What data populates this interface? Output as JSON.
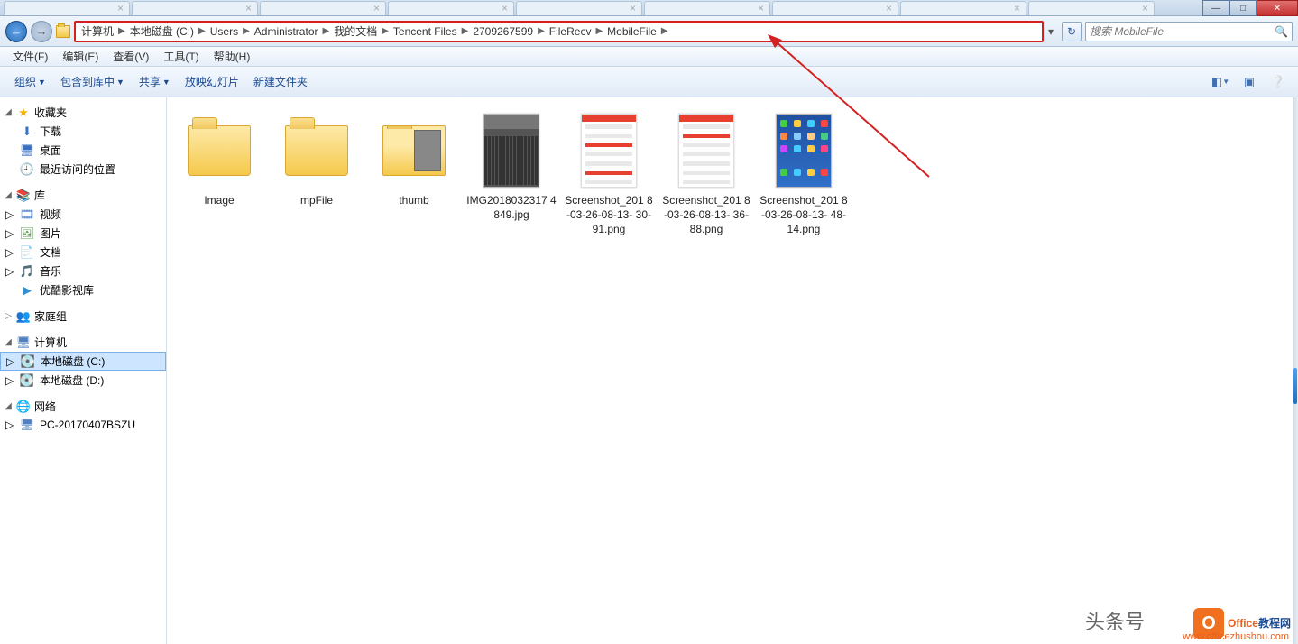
{
  "window": {
    "minimize": "—",
    "maximize": "□",
    "close": "✕"
  },
  "tabs": [
    {
      "label": " "
    },
    {
      "label": " "
    },
    {
      "label": " "
    },
    {
      "label": " "
    },
    {
      "label": " "
    },
    {
      "label": " "
    },
    {
      "label": " "
    },
    {
      "label": " "
    },
    {
      "label": " "
    },
    {
      "label": " "
    }
  ],
  "nav": {
    "back": "←",
    "forward": "→",
    "refresh": "↻"
  },
  "breadcrumb": [
    "计算机",
    "本地磁盘 (C:)",
    "Users",
    "Administrator",
    "我的文档",
    "Tencent Files",
    "2709267599",
    "FileRecv",
    "MobileFile"
  ],
  "search": {
    "placeholder": "搜索 MobileFile"
  },
  "menu": [
    "文件(F)",
    "编辑(E)",
    "查看(V)",
    "工具(T)",
    "帮助(H)"
  ],
  "toolbar": {
    "organize": "组织",
    "include": "包含到库中",
    "share": "共享",
    "slideshow": "放映幻灯片",
    "newfolder": "新建文件夹"
  },
  "sidebar": {
    "favorites": {
      "title": "收藏夹",
      "items": [
        "下载",
        "桌面",
        "最近访问的位置"
      ]
    },
    "libraries": {
      "title": "库",
      "items": [
        "视频",
        "图片",
        "文档",
        "音乐",
        "优酷影视库"
      ]
    },
    "homegroup": {
      "title": "家庭组"
    },
    "computer": {
      "title": "计算机",
      "items": [
        "本地磁盘 (C:)",
        "本地磁盘 (D:)"
      ]
    },
    "network": {
      "title": "网络",
      "items": [
        "PC-20170407BSZU"
      ]
    }
  },
  "files": [
    {
      "name": "Image",
      "type": "folder"
    },
    {
      "name": "mpFile",
      "type": "folder"
    },
    {
      "name": "thumb",
      "type": "folder-thumb"
    },
    {
      "name": "IMG2018032317\n4849.jpg",
      "type": "img-kb"
    },
    {
      "name": "Screenshot_201\n8-03-26-08-13-\n30-91.png",
      "type": "img-ss"
    },
    {
      "name": "Screenshot_201\n8-03-26-08-13-\n36-88.png",
      "type": "img-ss2"
    },
    {
      "name": "Screenshot_201\n8-03-26-08-13-\n48-14.png",
      "type": "img-phone"
    }
  ],
  "watermark": {
    "headline": "头条号",
    "brand": "Office教程网",
    "url": "www.officezhushou.com"
  }
}
